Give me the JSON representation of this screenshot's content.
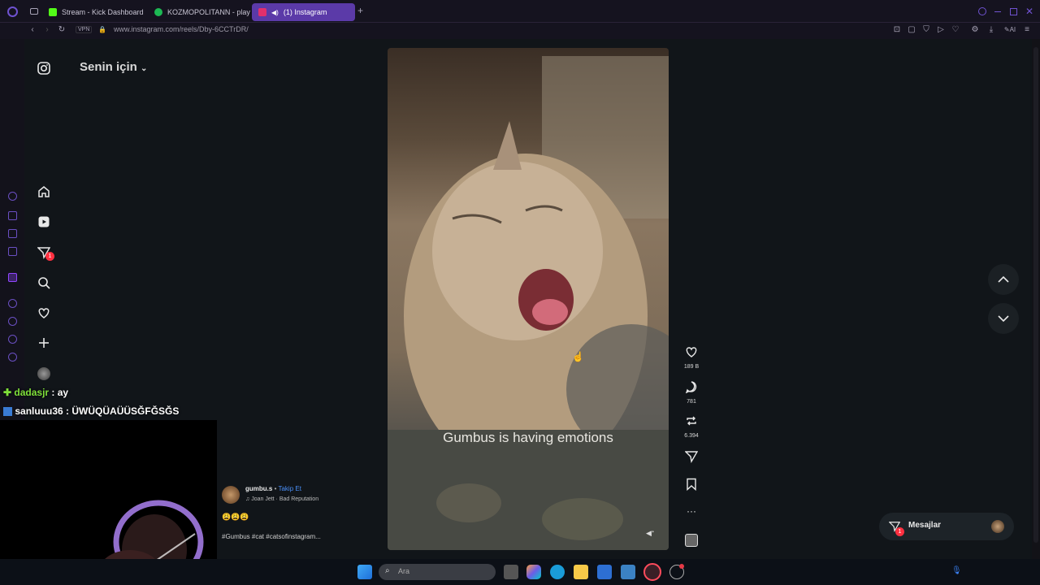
{
  "browser": {
    "tabs": [
      {
        "label": "Stream - Kick Dashboard",
        "color": "#53fc18"
      },
      {
        "label": "KOZMOPOLITANN - playlis",
        "color": "#1db954"
      },
      {
        "label": "(1) Instagram",
        "color": "#e1306c",
        "active": true
      }
    ],
    "url": "www.instagram.com/reels/Dby-6CCTrDR/",
    "vpn_label": "VPN",
    "ai_label": "AI"
  },
  "instagram": {
    "feed_selector": "Senin için",
    "nav": [
      "home-icon",
      "reels-icon",
      "messages-icon",
      "search-icon",
      "heart-icon",
      "create-icon",
      "profile-icon"
    ],
    "messages_badge": "1",
    "reel": {
      "caption": "Gumbus is having emotions",
      "author": "gumbu.s",
      "follow_label": "Takip Et",
      "music": "Joan Jett · Bad Reputation",
      "emojis": "😩😩😩",
      "hashtags": "#Gumbus #cat #catsofinstagram..."
    },
    "actions": [
      {
        "icon": "heart-icon",
        "count": "189 B"
      },
      {
        "icon": "comment-icon",
        "count": "781"
      },
      {
        "icon": "repost-icon",
        "count": "6.394"
      },
      {
        "icon": "send-icon",
        "count": ""
      },
      {
        "icon": "bookmark-icon",
        "count": ""
      },
      {
        "icon": "more-icon",
        "count": ""
      }
    ],
    "messages_button": {
      "label": "Mesajlar",
      "badge": "1"
    }
  },
  "stream_chat": [
    {
      "user": "dadasjr",
      "text": " : ay",
      "user_color": "#7fe03a"
    },
    {
      "user": "sanluuu36",
      "text": " : ÜWÜQÜAÜÜSĞFĞSĞS",
      "user_color": "#ffffff"
    }
  ],
  "taskbar": {
    "search_placeholder": "Ara"
  }
}
